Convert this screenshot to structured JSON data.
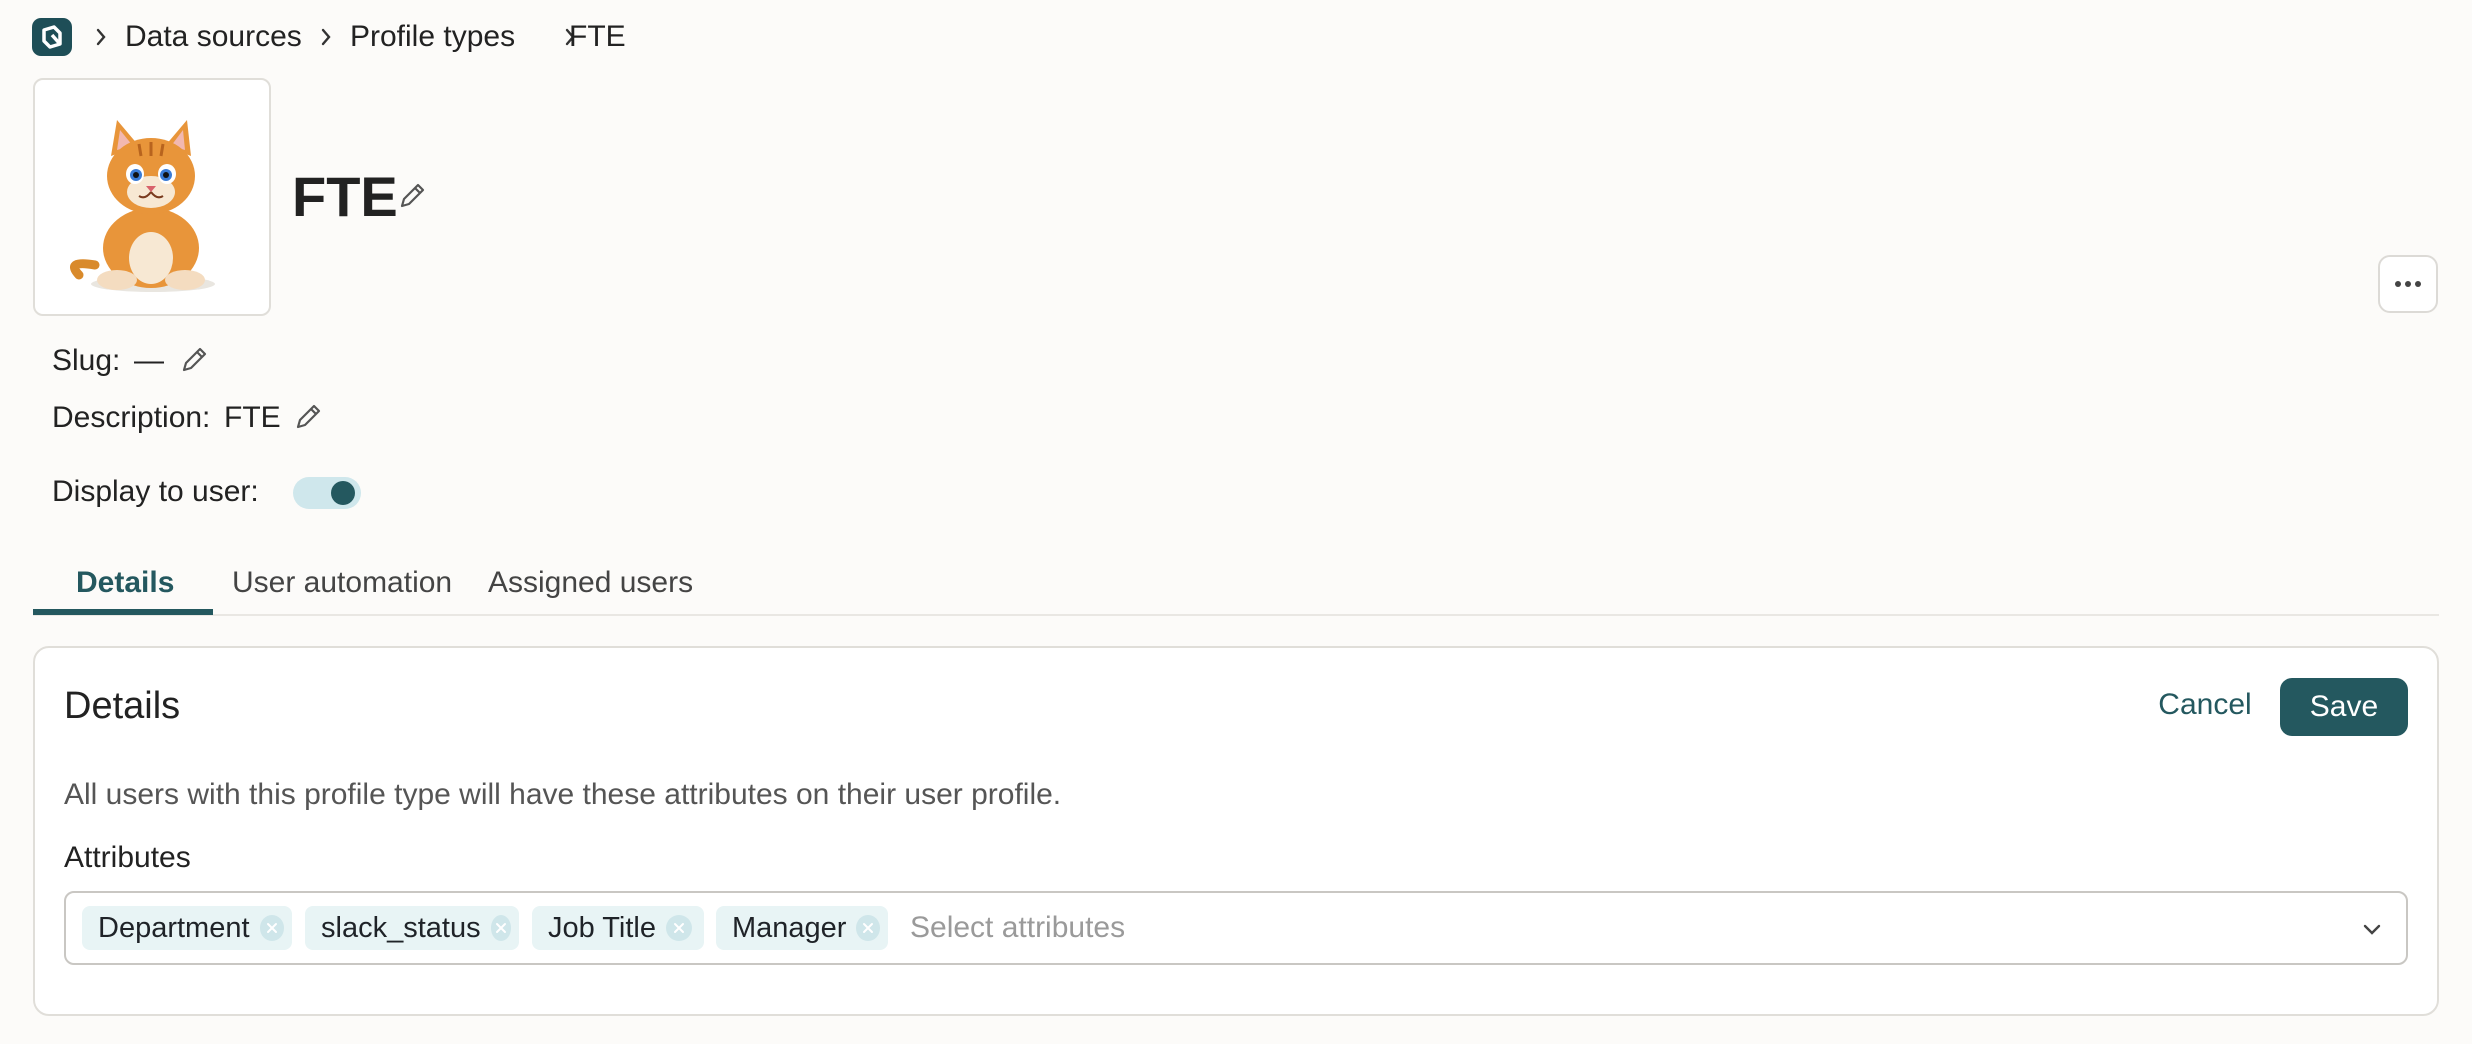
{
  "breadcrumb": {
    "items": [
      "Data sources",
      "Profile types",
      "FTE"
    ]
  },
  "profile": {
    "title": "FTE",
    "slug_label": "Slug:",
    "slug_value": "—",
    "description_label": "Description:",
    "description_value": "FTE",
    "display_label": "Display to user:",
    "display_to_user": true
  },
  "tabs": [
    {
      "label": "Details",
      "active": true
    },
    {
      "label": "User automation",
      "active": false
    },
    {
      "label": "Assigned users",
      "active": false
    }
  ],
  "details": {
    "title": "Details",
    "cancel_label": "Cancel",
    "save_label": "Save",
    "help_text": "All users with this profile type will have these attributes on their user profile.",
    "attributes_label": "Attributes",
    "attributes": [
      "Department",
      "slack_status",
      "Job Title",
      "Manager"
    ],
    "placeholder": "Select attributes"
  },
  "colors": {
    "accent": "#24585f",
    "chip_bg": "#e8f4f5",
    "background": "#fcfbf9"
  },
  "icons": {
    "logo": "app-logo-icon",
    "separator": "chevron-right-icon",
    "edit": "pencil-icon",
    "more": "more-horizontal-icon",
    "remove": "close-circle-icon",
    "dropdown": "chevron-down-icon"
  }
}
